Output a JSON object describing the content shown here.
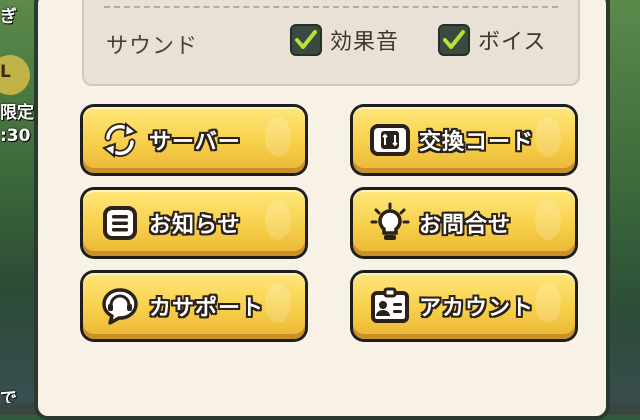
{
  "background": {
    "fragments": [
      "ぎ",
      "L",
      "限定",
      ":30",
      "で"
    ]
  },
  "sound_settings": {
    "label": "サウンド",
    "options": [
      {
        "label": "効果音",
        "checked": true
      },
      {
        "label": "ボイス",
        "checked": true
      }
    ]
  },
  "menu": {
    "buttons": [
      {
        "label": "サーバー",
        "icon": "refresh-icon"
      },
      {
        "label": "交換コード",
        "icon": "exchange-code-icon"
      },
      {
        "label": "お知らせ",
        "icon": "notice-icon"
      },
      {
        "label": "お問合せ",
        "icon": "lightbulb-icon"
      },
      {
        "label": "カサポート",
        "icon": "support-chat-icon"
      },
      {
        "label": "アカウント",
        "icon": "account-card-icon"
      }
    ]
  },
  "colors": {
    "button_yellow": "#f7cf4a",
    "checkbox_bg": "#3b4a3f",
    "check_green": "#b6e03a",
    "panel_bg": "#f7f1e6"
  }
}
